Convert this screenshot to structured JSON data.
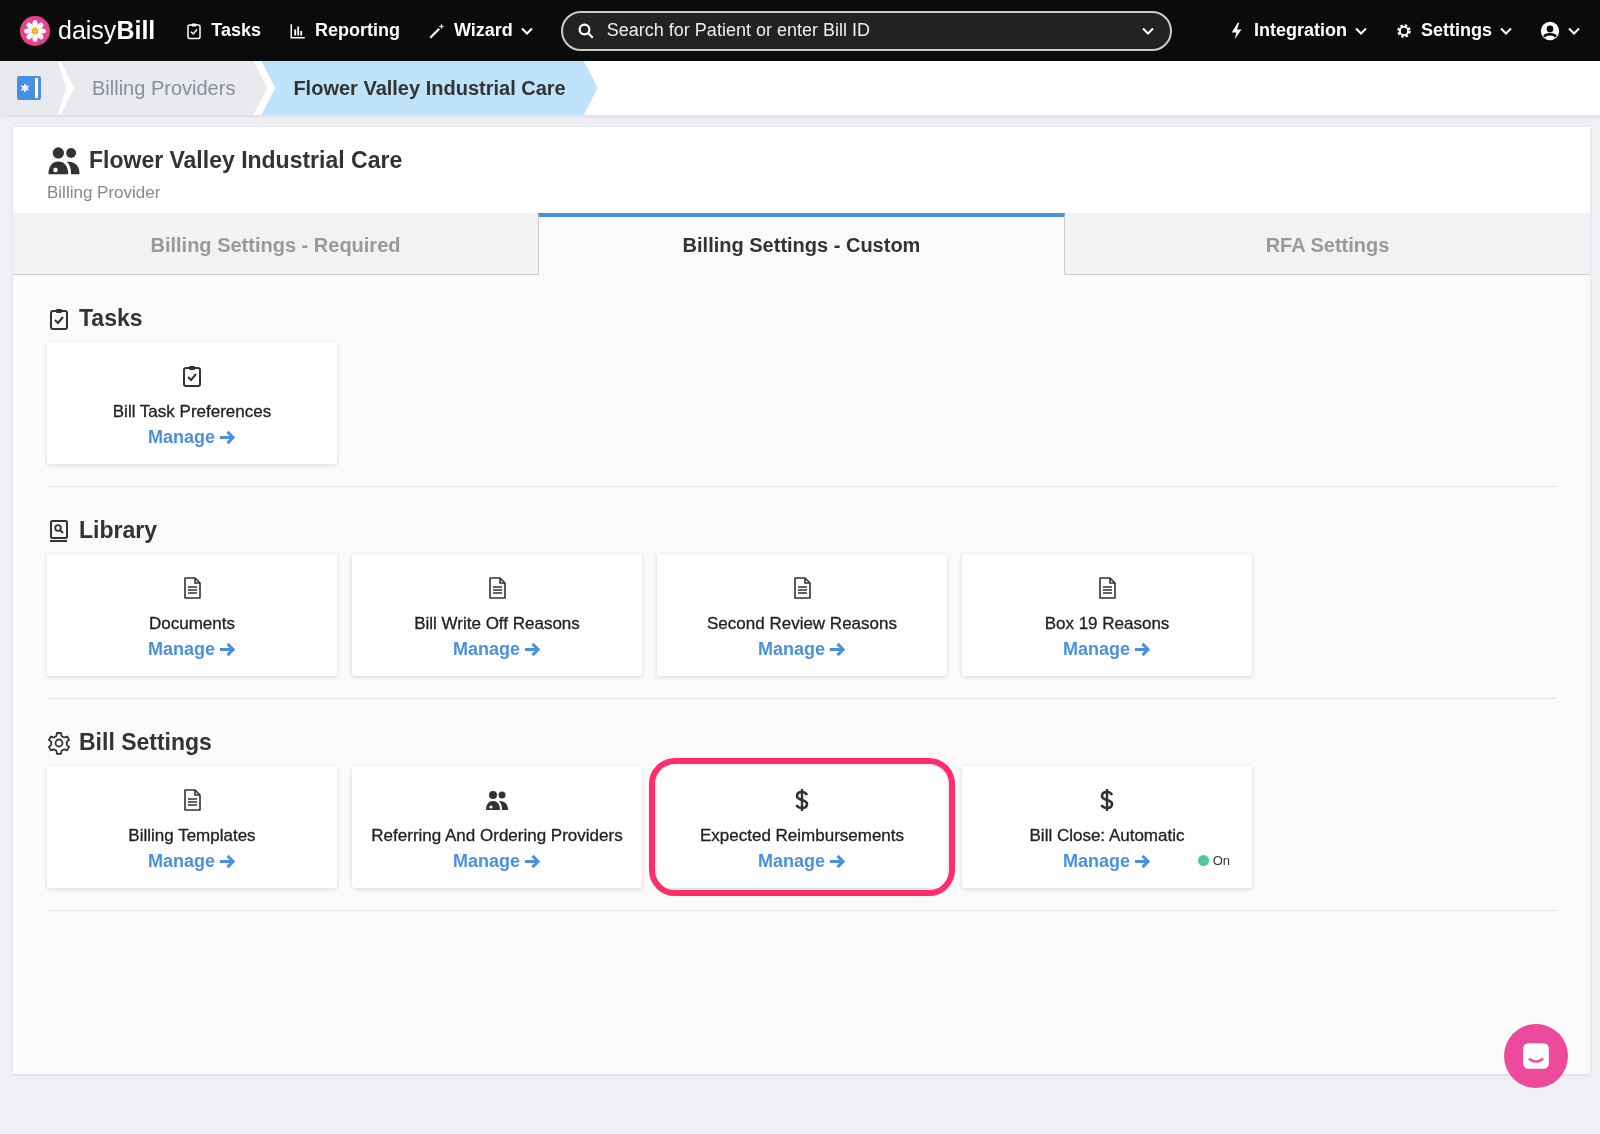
{
  "navbar": {
    "logo": {
      "light": "daisy",
      "bold": "Bill"
    },
    "items": [
      {
        "label": "Tasks",
        "kind": "clipboard",
        "dropdown": false
      },
      {
        "label": "Reporting",
        "kind": "chart",
        "dropdown": false
      },
      {
        "label": "Wizard",
        "kind": "wand",
        "dropdown": true
      }
    ],
    "search": {
      "placeholder": "Search for Patient or enter Bill ID"
    },
    "right_items": [
      {
        "label": "Integration",
        "kind": "bolt",
        "dropdown": true
      },
      {
        "label": "Settings",
        "kind": "gear",
        "dropdown": true
      }
    ]
  },
  "breadcrumb": [
    {
      "label": "Billing Providers",
      "selected": false
    },
    {
      "label": "Flower Valley Industrial Care",
      "selected": true
    }
  ],
  "header": {
    "title": "Flower Valley Industrial Care",
    "subtitle": "Billing Provider"
  },
  "tabs": [
    {
      "label": "Billing Settings - Required",
      "selected": false
    },
    {
      "label": "Billing Settings - Custom",
      "selected": true
    },
    {
      "label": "RFA Settings",
      "selected": false
    }
  ],
  "sections": [
    {
      "title": "Tasks",
      "kind": "clipboard",
      "cards": [
        {
          "kind": "clipboard",
          "title": "Bill Task Preferences",
          "link": "Manage",
          "highlighted": false
        }
      ]
    },
    {
      "title": "Library",
      "kind": "library",
      "cards": [
        {
          "kind": "document",
          "title": "Documents",
          "link": "Manage",
          "highlighted": false
        },
        {
          "kind": "document",
          "title": "Bill Write Off Reasons",
          "link": "Manage",
          "highlighted": false
        },
        {
          "kind": "document",
          "title": "Second Review Reasons",
          "link": "Manage",
          "highlighted": false
        },
        {
          "kind": "document",
          "title": "Box 19 Reasons",
          "link": "Manage",
          "highlighted": false
        }
      ]
    },
    {
      "title": "Bill Settings",
      "kind": "gear",
      "cards": [
        {
          "kind": "document",
          "title": "Billing Templates",
          "link": "Manage",
          "highlighted": false
        },
        {
          "kind": "people",
          "title": "Referring And Ordering Providers",
          "link": "Manage",
          "highlighted": false
        },
        {
          "kind": "dollar",
          "title": "Expected Reimbursements",
          "link": "Manage",
          "highlighted": true
        },
        {
          "kind": "dollar",
          "title": "Bill Close: Automatic",
          "link": "Manage",
          "highlighted": false,
          "status": {
            "label": "On",
            "color": "#4fc89a"
          }
        }
      ]
    }
  ]
}
